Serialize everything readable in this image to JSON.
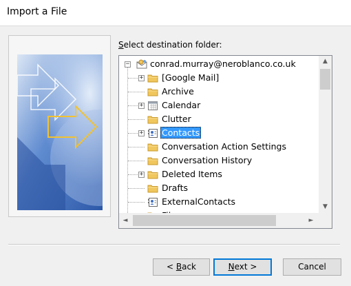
{
  "window": {
    "title": "Import a File"
  },
  "prompt": {
    "pre": "",
    "accel": "S",
    "post": "elect destination folder:"
  },
  "tree": {
    "root": {
      "label": "conrad.murray@neroblanco.co.uk",
      "expander": "−",
      "icon": "account-icon"
    },
    "items": [
      {
        "label": "[Google Mail]",
        "icon": "folder-icon",
        "expander": "+"
      },
      {
        "label": "Archive",
        "icon": "folder-icon",
        "expander": ""
      },
      {
        "label": "Calendar",
        "icon": "calendar-icon",
        "expander": "+"
      },
      {
        "label": "Clutter",
        "icon": "folder-icon",
        "expander": ""
      },
      {
        "label": "Contacts",
        "icon": "contacts-icon",
        "expander": "+",
        "selected": true
      },
      {
        "label": "Conversation Action Settings",
        "icon": "folder-icon",
        "expander": ""
      },
      {
        "label": "Conversation History",
        "icon": "folder-icon",
        "expander": ""
      },
      {
        "label": "Deleted Items",
        "icon": "folder-icon",
        "expander": "+"
      },
      {
        "label": "Drafts",
        "icon": "folder-icon",
        "expander": ""
      },
      {
        "label": "ExternalContacts",
        "icon": "contacts-icon",
        "expander": ""
      },
      {
        "label": "Files",
        "icon": "folder-icon",
        "expander": ""
      }
    ]
  },
  "scroll": {
    "up": "▲",
    "down": "▼",
    "left": "◄",
    "right": "►"
  },
  "buttons": {
    "back": {
      "pre": "< ",
      "accel": "B",
      "post": "ack"
    },
    "next": {
      "pre": "",
      "accel": "N",
      "post": "ext >"
    },
    "cancel": {
      "label": "Cancel"
    }
  },
  "colors": {
    "selection": "#3399ff",
    "folder": "#f0c75e",
    "accent": "#0078d7"
  }
}
